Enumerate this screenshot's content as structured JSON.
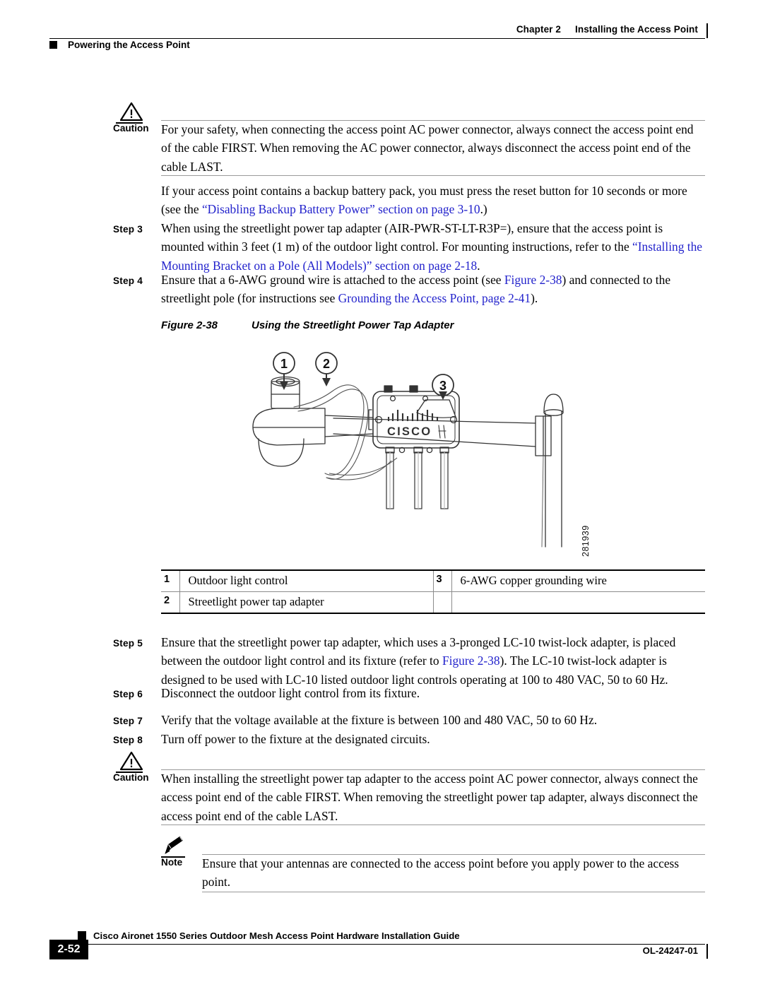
{
  "header": {
    "chapter": "Chapter 2",
    "chapter_title": "Installing the Access Point",
    "section": "Powering the Access Point"
  },
  "caution1": {
    "label": "Caution",
    "icon": "warning-triangle-icon",
    "text": "For your safety, when connecting the access point AC power connector, always connect the access point end of the cable FIRST. When removing the AC power connector, always disconnect the access point end of the cable LAST."
  },
  "intro_para": {
    "t1": "If your access point contains a backup battery pack, you must press the reset button for 10 seconds or more (see the ",
    "link": "“Disabling Backup Battery Power” section on page 3-10",
    "t2": ".)"
  },
  "steps_top": [
    {
      "label": "Step 3",
      "t1": "When using the streetlight power tap adapter (AIR-PWR-ST-LT-R3P=), ensure that the access point is mounted within 3 feet (1 m) of the outdoor light control. For mounting instructions, refer to the ",
      "link": "“Installing the Mounting Bracket on a Pole (All Models)” section on page 2-18",
      "t2": "."
    },
    {
      "label": "Step 4",
      "t1": "Ensure that a 6-AWG ground wire is attached to the access point (see ",
      "link": "Figure 2-38",
      "t2": ") and connected to the streetlight pole (for instructions see ",
      "link2": "Grounding the Access Point, page 2-41",
      "t3": ")."
    }
  ],
  "figure": {
    "number": "Figure 2-38",
    "title": "Using the Streetlight Power Tap Adapter",
    "art_id": "281939",
    "callouts": [
      "1",
      "2",
      "3"
    ],
    "device_brand": "CISCO"
  },
  "legend": {
    "rows": [
      {
        "n1": "1",
        "t1": "Outdoor light control",
        "n2": "3",
        "t2": "6-AWG copper grounding wire"
      },
      {
        "n1": "2",
        "t1": "Streetlight power tap adapter",
        "n2": "",
        "t2": ""
      }
    ]
  },
  "steps_bottom": [
    {
      "label": "Step 5",
      "t1": "Ensure that the streetlight power tap adapter, which uses a 3-pronged LC-10 twist-lock adapter, is placed between the outdoor light control and its fixture (refer to ",
      "link": "Figure 2-38",
      "t2": "). The LC-10 twist-lock adapter is designed to be used with LC-10 listed outdoor light controls operating at 100 to 480 VAC, 50 to 60 Hz."
    },
    {
      "label": "Step 6",
      "t1": "Disconnect the outdoor light control from its fixture."
    },
    {
      "label": "Step 7",
      "t1": "Verify that the voltage available at the fixture is between 100 and 480 VAC, 50 to 60 Hz."
    },
    {
      "label": "Step 8",
      "t1": "Turn off power to the fixture at the designated circuits."
    }
  ],
  "caution2": {
    "label": "Caution",
    "icon": "warning-triangle-icon",
    "text": "When installing the streetlight power tap adapter to the access point AC power connector, always connect the access point end of the cable FIRST. When removing the streetlight power tap adapter, always disconnect the access point end of the cable LAST."
  },
  "note": {
    "label": "Note",
    "icon": "pencil-icon",
    "text": "Ensure that your antennas are connected to the access point before you apply power to the access point."
  },
  "footer": {
    "page": "2-52",
    "title": "Cisco Aironet 1550 Series Outdoor Mesh Access Point Hardware Installation Guide",
    "doc_id": "OL-24247-01"
  },
  "colors": {
    "link": "#2222cc",
    "rule": "#9a9a9a",
    "ink": "#000000"
  }
}
